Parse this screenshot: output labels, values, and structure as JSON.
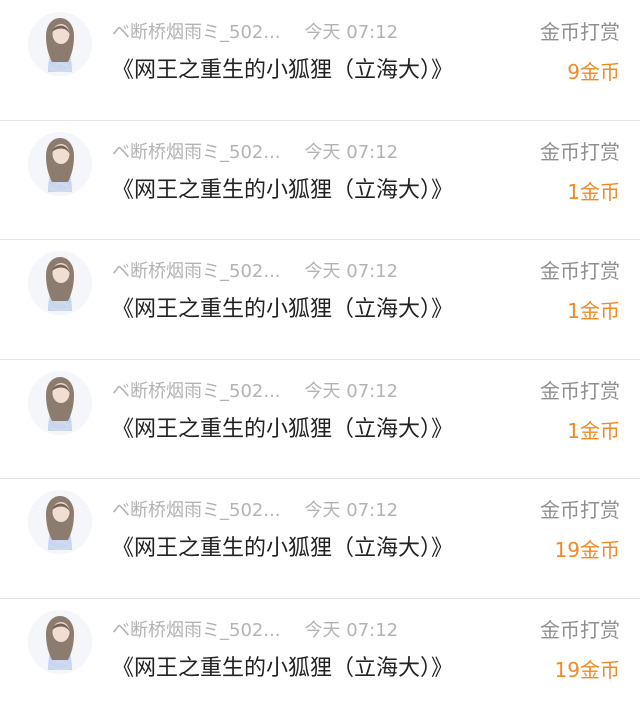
{
  "colors": {
    "amount": "#f08a24",
    "secondary_text": "#b3b3b3",
    "action_text": "#8f8f8f",
    "primary_text": "#222222",
    "divider": "#e6e6e6"
  },
  "entries": [
    {
      "avatar_icon": "user-avatar-icon",
      "user": "ベ断桥烟雨ミ_502...",
      "time": "今天 07:12",
      "book": "《网王之重生的小狐狸（立海大）》",
      "action": "金币打赏",
      "amount": "9金币"
    },
    {
      "avatar_icon": "user-avatar-icon",
      "user": "ベ断桥烟雨ミ_502...",
      "time": "今天 07:12",
      "book": "《网王之重生的小狐狸（立海大）》",
      "action": "金币打赏",
      "amount": "1金币"
    },
    {
      "avatar_icon": "user-avatar-icon",
      "user": "ベ断桥烟雨ミ_502...",
      "time": "今天 07:12",
      "book": "《网王之重生的小狐狸（立海大）》",
      "action": "金币打赏",
      "amount": "1金币"
    },
    {
      "avatar_icon": "user-avatar-icon",
      "user": "ベ断桥烟雨ミ_502...",
      "time": "今天 07:12",
      "book": "《网王之重生的小狐狸（立海大）》",
      "action": "金币打赏",
      "amount": "1金币"
    },
    {
      "avatar_icon": "user-avatar-icon",
      "user": "ベ断桥烟雨ミ_502...",
      "time": "今天 07:12",
      "book": "《网王之重生的小狐狸（立海大）》",
      "action": "金币打赏",
      "amount": "19金币"
    },
    {
      "avatar_icon": "user-avatar-icon",
      "user": "ベ断桥烟雨ミ_502...",
      "time": "今天 07:12",
      "book": "《网王之重生的小狐狸（立海大）》",
      "action": "金币打赏",
      "amount": "19金币"
    }
  ]
}
